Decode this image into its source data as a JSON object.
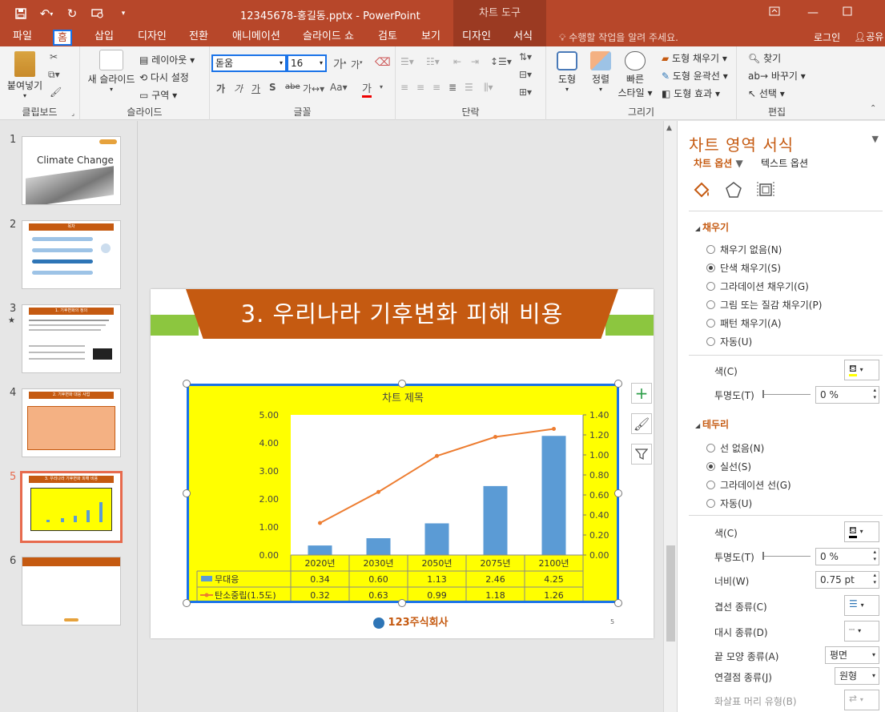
{
  "titlebar": {
    "title": "12345678-홍길동.pptx - PowerPoint",
    "context_tool": "차트 도구",
    "qat": [
      "save-icon",
      "undo-icon",
      "redo-icon",
      "present-icon",
      "customize-icon"
    ]
  },
  "tabs": [
    {
      "label": "파일"
    },
    {
      "label": "홈"
    },
    {
      "label": "삽입"
    },
    {
      "label": "디자인"
    },
    {
      "label": "전환"
    },
    {
      "label": "애니메이션"
    },
    {
      "label": "슬라이드 쇼"
    },
    {
      "label": "검토"
    },
    {
      "label": "보기"
    },
    {
      "label": "디자인"
    },
    {
      "label": "서식"
    }
  ],
  "tell_me": "수행할 작업을 알려 주세요.",
  "login": "로그인",
  "share": "공유",
  "ribbon": {
    "clipboard": {
      "label": "클립보드",
      "paste": "붙여넣기"
    },
    "slides": {
      "label": "슬라이드",
      "new_slide": "새 슬라이드",
      "layout": "레이아웃",
      "reset": "다시 설정",
      "section": "구역"
    },
    "font": {
      "label": "글꼴",
      "font_name": "돋움",
      "font_size": "16"
    },
    "paragraph": {
      "label": "단락"
    },
    "drawing": {
      "label": "그리기",
      "shape": "도형",
      "arrange": "정렬",
      "quick_style": "빠른",
      "quick_style2": "스타일",
      "fill": "도형 채우기",
      "outline": "도형 윤곽선",
      "effect": "도형 효과"
    },
    "editing": {
      "label": "편집",
      "find": "찾기",
      "replace": "바꾸기",
      "select": "선택"
    }
  },
  "slides": [
    {
      "num": "1"
    },
    {
      "num": "2"
    },
    {
      "num": "3"
    },
    {
      "num": "4"
    },
    {
      "num": "5"
    },
    {
      "num": "6"
    }
  ],
  "slide_text": {
    "thumb1_title": "Climate Change",
    "thumb2_header": "목차",
    "thumb3_header": "1. 기후변화의 정의",
    "thumb4_header": "2. 기후변화 대응 사업",
    "thumb5_header": "3. 우리나라 기후변화 피해 비용",
    "thumb3_star": "★"
  },
  "slide": {
    "title": "3. 우리나라 기후변화 피해 비용",
    "logo": "123주식회사",
    "page_number": "5"
  },
  "chart_data": {
    "type": "bar",
    "title": "차트 제목",
    "categories": [
      "2020년",
      "2030년",
      "2050년",
      "2075년",
      "2100년"
    ],
    "series": [
      {
        "name": "무대응",
        "type": "bar",
        "axis": "left",
        "values": [
          0.34,
          0.6,
          1.13,
          2.46,
          4.25
        ]
      },
      {
        "name": "탄소중립(1.5도)",
        "type": "line",
        "axis": "right",
        "values": [
          0.32,
          0.63,
          0.99,
          1.18,
          1.26
        ]
      }
    ],
    "y_left": {
      "ylim": [
        0,
        5
      ],
      "ticks": [
        "0.00",
        "1.00",
        "2.00",
        "3.00",
        "4.00",
        "5.00"
      ]
    },
    "y_right": {
      "ylim": [
        0,
        1.4
      ],
      "ticks": [
        "0.00",
        "0.20",
        "0.40",
        "0.60",
        "0.80",
        "1.00",
        "1.20",
        "1.40"
      ]
    },
    "data_table": true,
    "table_values": [
      [
        "0.34",
        "0.60",
        "1.13",
        "2.46",
        "4.25"
      ],
      [
        "0.32",
        "0.63",
        "0.99",
        "1.18",
        "1.26"
      ]
    ],
    "colors": {
      "bar": "#5b9bd5",
      "line": "#ed7d31",
      "background": "#ffff00"
    }
  },
  "format_pane": {
    "title": "차트 영역 서식",
    "tab_chart": "차트 옵션",
    "tab_text": "텍스트 옵션",
    "fill_section": "채우기",
    "fill_options": [
      {
        "label": "채우기 없음(N)",
        "checked": false
      },
      {
        "label": "단색 채우기(S)",
        "checked": true
      },
      {
        "label": "그라데이션 채우기(G)",
        "checked": false
      },
      {
        "label": "그림 또는 질감 채우기(P)",
        "checked": false
      },
      {
        "label": "패턴 채우기(A)",
        "checked": false
      },
      {
        "label": "자동(U)",
        "checked": false
      }
    ],
    "fill_color_label": "색(C)",
    "fill_transparency_label": "투명도(T)",
    "fill_transparency": "0 %",
    "border_section": "테두리",
    "border_options": [
      {
        "label": "선 없음(N)",
        "checked": false
      },
      {
        "label": "실선(S)",
        "checked": true
      },
      {
        "label": "그라데이션 선(G)",
        "checked": false
      },
      {
        "label": "자동(U)",
        "checked": false
      }
    ],
    "border_color_label": "색(C)",
    "border_transparency_label": "투명도(T)",
    "border_transparency": "0 %",
    "width_label": "너비(W)",
    "width_value": "0.75 pt",
    "compound_label": "겹선 종류(C)",
    "dash_label": "대시 종류(D)",
    "cap_label": "끝 모양 종류(A)",
    "cap_value": "평면",
    "join_label": "연결점 종류(J)",
    "join_value": "원형",
    "arrow_label": "화살표 머리 유형(B)"
  }
}
